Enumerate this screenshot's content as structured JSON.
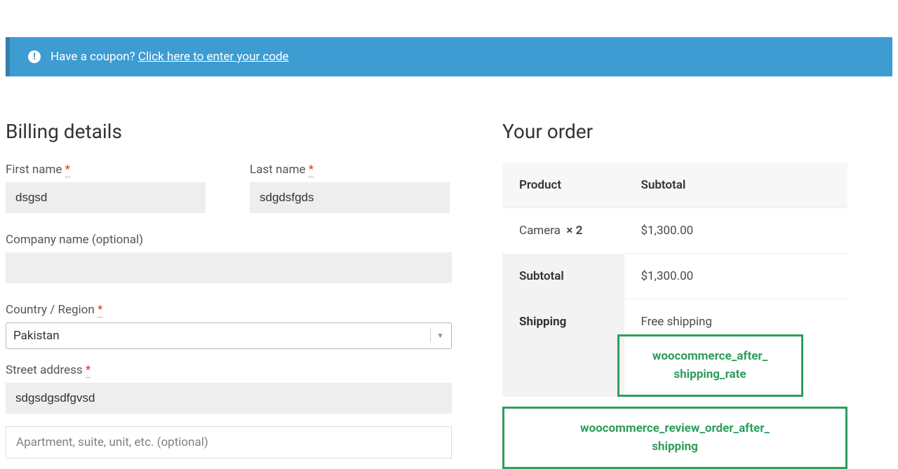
{
  "coupon": {
    "question": "Have a coupon?",
    "link_text": "Click here to enter your code"
  },
  "billing": {
    "title": "Billing details",
    "first_name": {
      "label": "First name",
      "value": "dsgsd"
    },
    "last_name": {
      "label": "Last name",
      "value": "sdgdsfgds"
    },
    "company": {
      "label": "Company name (optional)",
      "value": ""
    },
    "country": {
      "label": "Country / Region",
      "value": "Pakistan"
    },
    "street": {
      "label": "Street address",
      "value": "sdgsdgsdfgvsd"
    },
    "street2_placeholder": "Apartment, suite, unit, etc. (optional)"
  },
  "order": {
    "title": "Your order",
    "headers": {
      "product": "Product",
      "subtotal": "Subtotal"
    },
    "items": [
      {
        "name": "Camera",
        "qty": "× 2",
        "subtotal": "$1,300.00"
      }
    ],
    "subtotal": {
      "label": "Subtotal",
      "value": "$1,300.00"
    },
    "shipping": {
      "label": "Shipping",
      "value": "Free shipping"
    },
    "hooks": {
      "after_shipping_rate": "woocommerce_after_\nshipping_rate",
      "review_order_after_shipping": "woocommerce_review_order_after_\nshipping"
    }
  }
}
